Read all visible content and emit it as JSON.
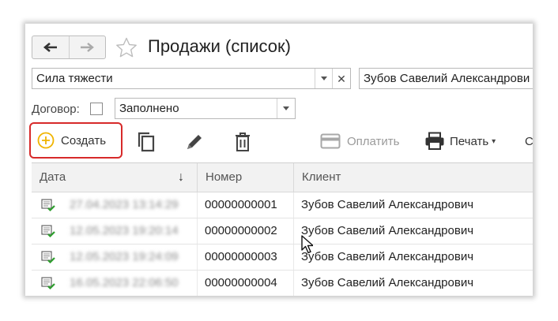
{
  "window": {
    "title": "Продажи (список)"
  },
  "filters": {
    "organization": {
      "value": "Сила тяжести"
    },
    "client": {
      "value": "Зубов Савелий Александрови"
    },
    "contract_label": "Договор:",
    "contract_checked": false,
    "contract_value": "Заполнено"
  },
  "toolbar": {
    "create_label": "Создать",
    "pay_label": "Оплатить",
    "print_label": "Печать",
    "more_label": "С"
  },
  "table": {
    "columns": [
      "Дата",
      "Номер",
      "Клиент"
    ],
    "sort_indicator": "↓",
    "rows": [
      {
        "date": "27.04.2023 13:14:29",
        "number": "00000000001",
        "client": "Зубов Савелий Александрович"
      },
      {
        "date": "12.05.2023 19:20:14",
        "number": "00000000002",
        "client": "Зубов Савелий Александрович"
      },
      {
        "date": "12.05.2023 19:24:09",
        "number": "00000000003",
        "client": "Зубов Савелий Александрович"
      },
      {
        "date": "16.05.2023 22:06:50",
        "number": "00000000004",
        "client": "Зубов Савелий Александрович"
      }
    ]
  },
  "colors": {
    "highlight": "#d72a2a",
    "create_icon": "#f0b400",
    "doc_check": "#2e9e2e"
  },
  "icons": [
    "arrow-left-icon",
    "arrow-right-icon",
    "star-icon",
    "chevron-down-icon",
    "close-icon",
    "plus-circle-icon",
    "copy-icon",
    "pencil-icon",
    "trash-icon",
    "card-icon",
    "printer-icon",
    "document-check-icon",
    "mouse-cursor-icon"
  ]
}
